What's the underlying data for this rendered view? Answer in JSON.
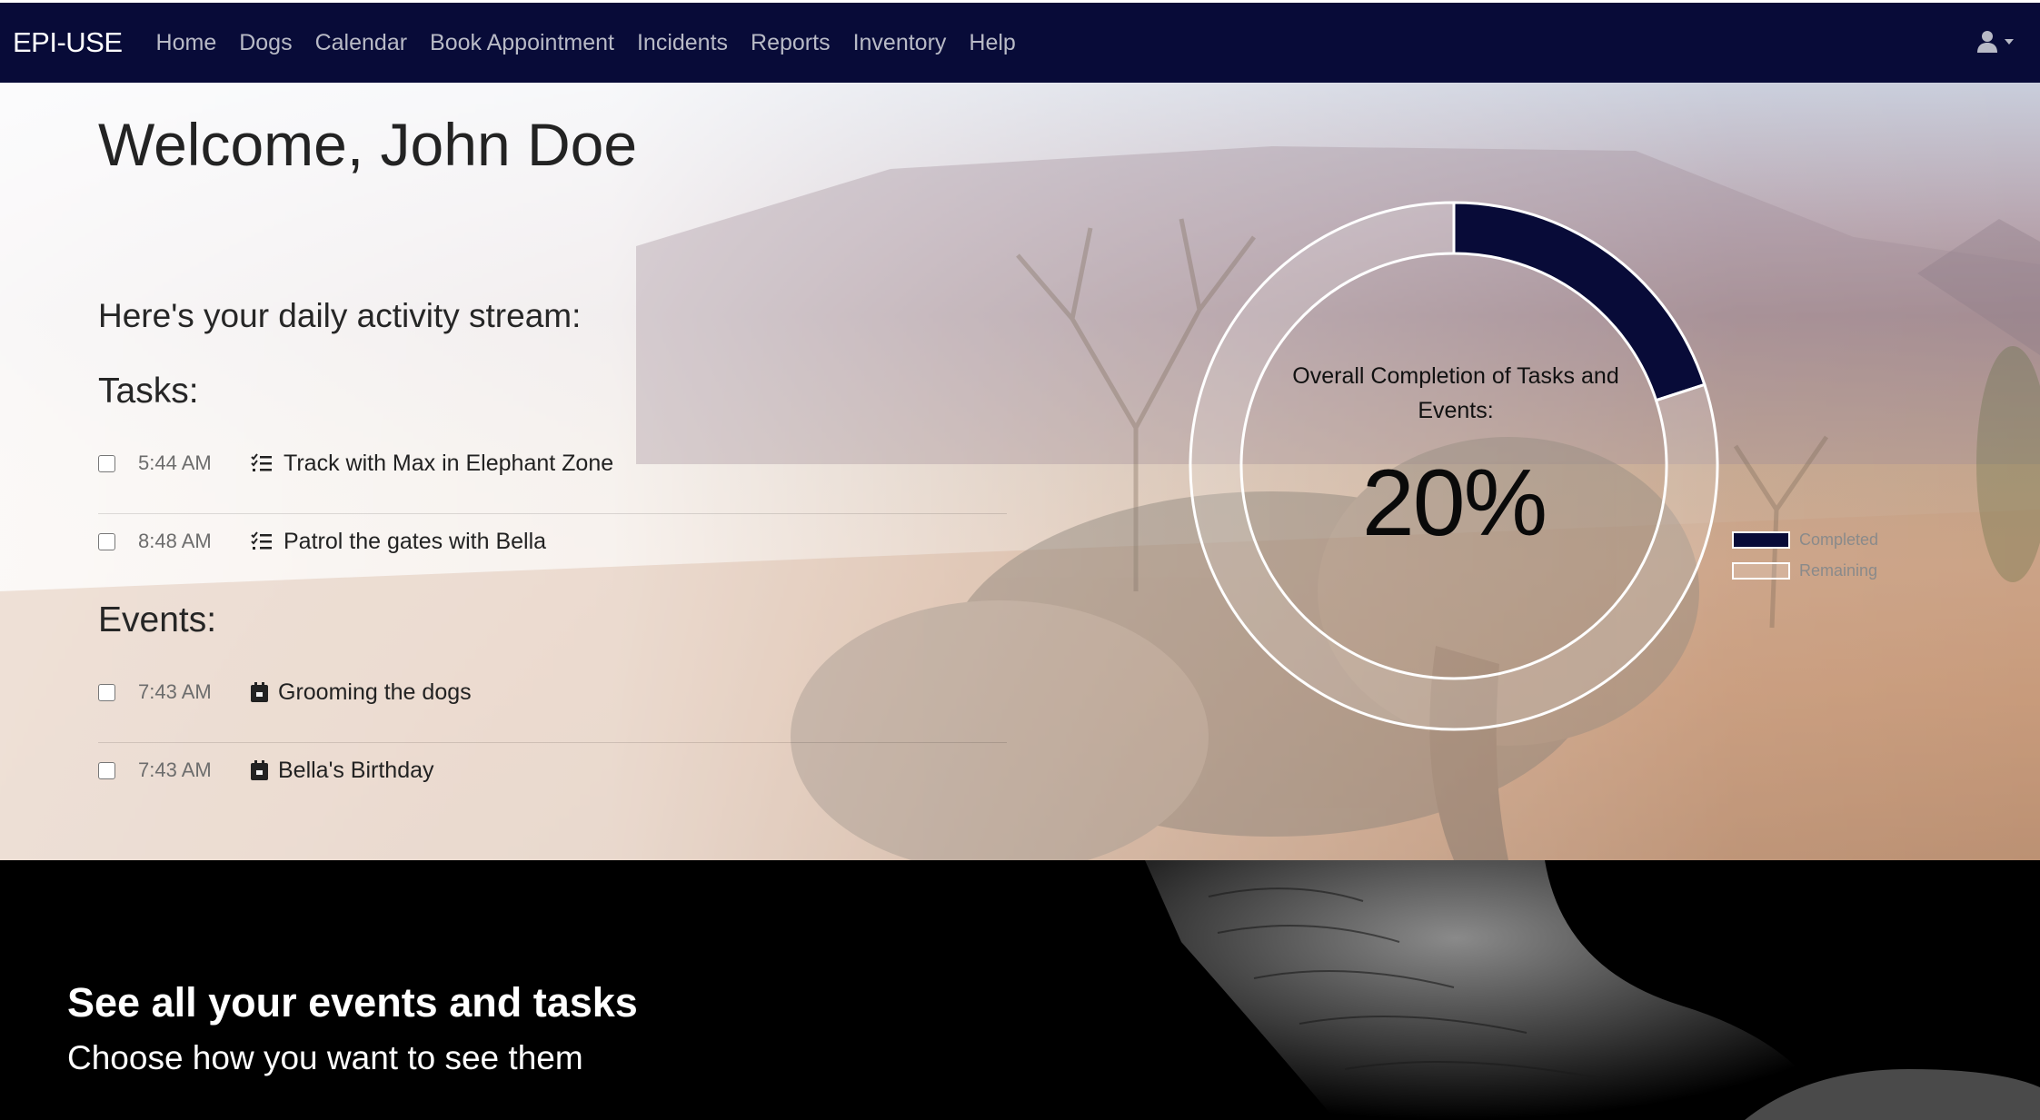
{
  "navbar": {
    "brand": "EPI-USE",
    "links": [
      "Home",
      "Dogs",
      "Calendar",
      "Book Appointment",
      "Incidents",
      "Reports",
      "Inventory",
      "Help"
    ],
    "user_icon": "user-icon",
    "user_caret": "caret-down-icon"
  },
  "welcome": {
    "title": "Welcome, John Doe"
  },
  "activity": {
    "heading": "Here's your daily activity stream:",
    "tasks_heading": "Tasks:",
    "tasks": [
      {
        "time": "5:44 AM",
        "icon": "task-list-icon",
        "label": "Track with Max in Elephant Zone",
        "checked": false
      },
      {
        "time": "8:48 AM",
        "icon": "task-list-icon",
        "label": "Patrol the gates with Bella",
        "checked": false
      }
    ],
    "events_heading": "Events:",
    "events": [
      {
        "time": "7:43 AM",
        "icon": "calendar-icon",
        "label": "Grooming the dogs",
        "checked": false
      },
      {
        "time": "7:43 AM",
        "icon": "calendar-icon",
        "label": "Bella's Birthday",
        "checked": false
      }
    ]
  },
  "chart_data": {
    "type": "pie",
    "caption": "Overall Completion of Tasks and Events:",
    "center_label": "20%",
    "categories": [
      "Completed",
      "Remaining"
    ],
    "values": [
      20,
      80
    ],
    "colors": [
      "#080b38",
      "rgba(255,255,255,0.15)"
    ],
    "legend_position": "right"
  },
  "banner": {
    "title": "See all your events and tasks",
    "subtitle": "Choose how you want to see them"
  }
}
